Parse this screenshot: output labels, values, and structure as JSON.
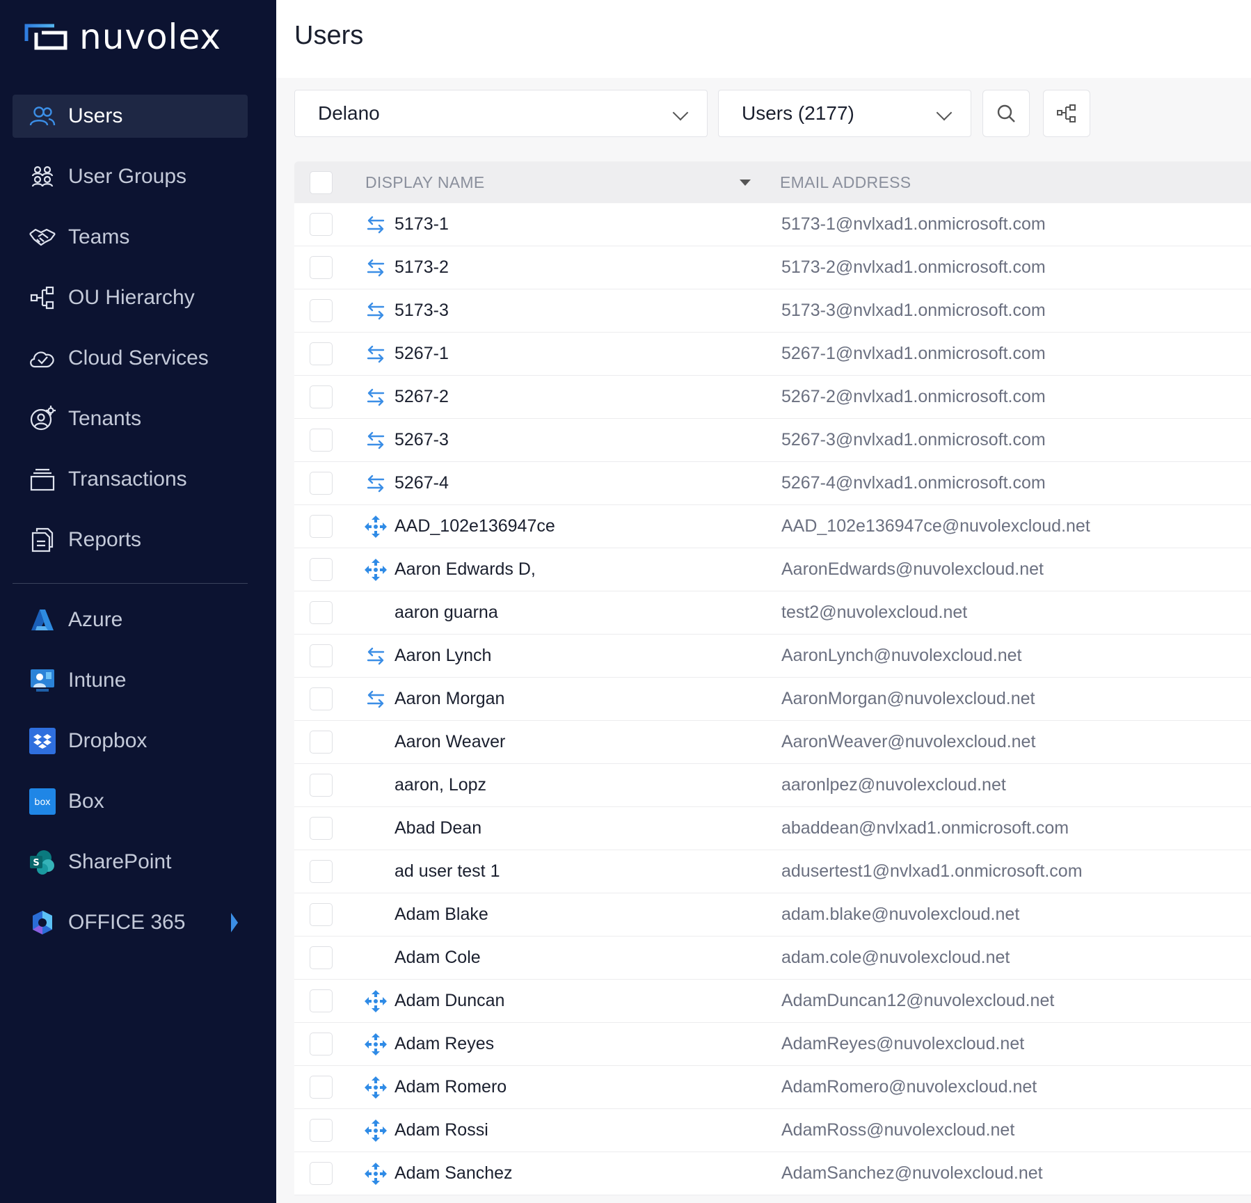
{
  "brand": {
    "name": "nuvolex",
    "accent": "#3b8ee6"
  },
  "sidebar": {
    "items": [
      {
        "label": "Users",
        "icon": "users-icon",
        "active": true
      },
      {
        "label": "User Groups",
        "icon": "user-groups-icon"
      },
      {
        "label": "Teams",
        "icon": "handshake-icon"
      },
      {
        "label": "OU Hierarchy",
        "icon": "hierarchy-icon"
      },
      {
        "label": "Cloud Services",
        "icon": "cloud-check-icon"
      },
      {
        "label": "Tenants",
        "icon": "tenant-gear-icon"
      },
      {
        "label": "Transactions",
        "icon": "stack-icon"
      },
      {
        "label": "Reports",
        "icon": "report-icon"
      }
    ],
    "services": [
      {
        "label": "Azure",
        "icon": "azure-icon"
      },
      {
        "label": "Intune",
        "icon": "intune-icon"
      },
      {
        "label": "Dropbox",
        "icon": "dropbox-icon"
      },
      {
        "label": "Box",
        "icon": "box-icon"
      },
      {
        "label": "SharePoint",
        "icon": "sharepoint-icon"
      },
      {
        "label": "OFFICE 365",
        "icon": "office365-icon"
      }
    ]
  },
  "main": {
    "title": "Users",
    "filters": {
      "tenant": "Delano",
      "view": "Users (2177)"
    },
    "table": {
      "headers": {
        "name": "DISPLAY NAME",
        "email": "EMAIL ADDRESS"
      },
      "rows": [
        {
          "name": "5173-1",
          "email": "5173-1@nvlxad1.onmicrosoft.com",
          "type": "sync"
        },
        {
          "name": "5173-2",
          "email": "5173-2@nvlxad1.onmicrosoft.com",
          "type": "sync"
        },
        {
          "name": "5173-3",
          "email": "5173-3@nvlxad1.onmicrosoft.com",
          "type": "sync"
        },
        {
          "name": "5267-1",
          "email": "5267-1@nvlxad1.onmicrosoft.com",
          "type": "sync"
        },
        {
          "name": "5267-2",
          "email": "5267-2@nvlxad1.onmicrosoft.com",
          "type": "sync"
        },
        {
          "name": "5267-3",
          "email": "5267-3@nvlxad1.onmicrosoft.com",
          "type": "sync"
        },
        {
          "name": "5267-4",
          "email": "5267-4@nvlxad1.onmicrosoft.com",
          "type": "sync"
        },
        {
          "name": "AAD_102e136947ce",
          "email": "AAD_102e136947ce@nuvolexcloud.net",
          "type": "azure"
        },
        {
          "name": "Aaron Edwards D,",
          "email": "AaronEdwards@nuvolexcloud.net",
          "type": "azure"
        },
        {
          "name": "aaron guarna",
          "email": "test2@nuvolexcloud.net",
          "type": "none"
        },
        {
          "name": "Aaron Lynch",
          "email": "AaronLynch@nuvolexcloud.net",
          "type": "sync"
        },
        {
          "name": "Aaron Morgan",
          "email": "AaronMorgan@nuvolexcloud.net",
          "type": "sync"
        },
        {
          "name": "Aaron Weaver",
          "email": "AaronWeaver@nuvolexcloud.net",
          "type": "none"
        },
        {
          "name": "aaron, Lopz",
          "email": "aaronlpez@nuvolexcloud.net",
          "type": "none"
        },
        {
          "name": "Abad Dean",
          "email": "abaddean@nvlxad1.onmicrosoft.com",
          "type": "none"
        },
        {
          "name": "ad user test 1",
          "email": "adusertest1@nvlxad1.onmicrosoft.com",
          "type": "none"
        },
        {
          "name": "Adam Blake",
          "email": "adam.blake@nuvolexcloud.net",
          "type": "none"
        },
        {
          "name": "Adam Cole",
          "email": "adam.cole@nuvolexcloud.net",
          "type": "none"
        },
        {
          "name": "Adam Duncan",
          "email": "AdamDuncan12@nuvolexcloud.net",
          "type": "azure"
        },
        {
          "name": "Adam Reyes",
          "email": "AdamReyes@nuvolexcloud.net",
          "type": "azure"
        },
        {
          "name": "Adam Romero",
          "email": "AdamRomero@nuvolexcloud.net",
          "type": "azure"
        },
        {
          "name": "Adam Rossi",
          "email": "AdamRoss@nuvolexcloud.net",
          "type": "azure"
        },
        {
          "name": "Adam Sanchez",
          "email": "AdamSanchez@nuvolexcloud.net",
          "type": "azure"
        }
      ]
    }
  }
}
